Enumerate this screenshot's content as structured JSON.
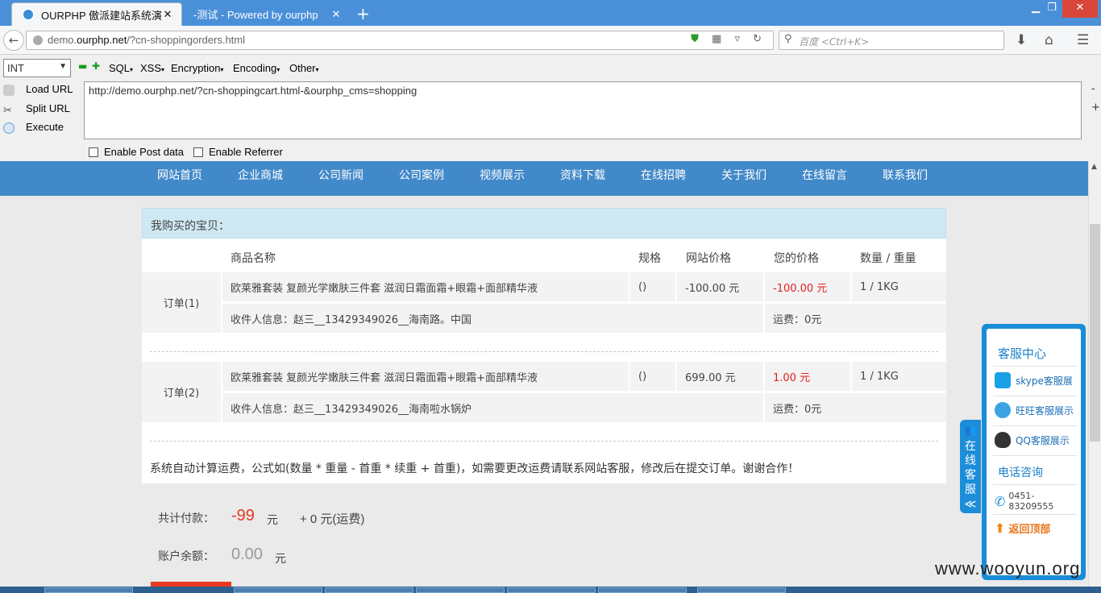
{
  "browser": {
    "tabs": [
      {
        "label": "OURPHP 傲派建站系统演..."
      },
      {
        "label": "-测试 - Powered by ourphp"
      }
    ],
    "url_prefix": "demo.",
    "url_domain": "ourphp.net",
    "url_path": "/?cn-shoppingorders.html",
    "search_placeholder": "百度 <Ctrl+K>"
  },
  "hackbar": {
    "select_value": "INT",
    "menus": [
      "SQL",
      "XSS",
      "Encryption",
      "Encoding",
      "Other"
    ],
    "actions": [
      "Load URL",
      "Split URL",
      "Execute"
    ],
    "text": "http://demo.ourphp.net/?cn-shoppingcart.html-&ourphp_cms=shopping",
    "post_label": "Enable Post data",
    "referrer_label": "Enable Referrer"
  },
  "site_nav": [
    "网站首页",
    "企业商城",
    "公司新闻",
    "公司案例",
    "视频展示",
    "资料下载",
    "在线招聘",
    "关于我们",
    "在线留言",
    "联系我们"
  ],
  "orders": {
    "heading": "我购买的宝贝：",
    "columns": [
      "商品名称",
      "规格",
      "网站价格",
      "您的价格",
      "数量 / 重量"
    ],
    "items": [
      {
        "order_label": "订单(1)",
        "product": "欧莱雅套装 复颜光学嫩肤三件套 滋润日霜面霜+眼霜+面部精华液",
        "spec": "()",
        "site_price": "-100.00 元",
        "your_price": "-100.00 元",
        "qty_weight": "1  /  1KG",
        "receiver": "收件人信息：赵三__13429349026__海南路。中国",
        "shipping": "运费：0元"
      },
      {
        "order_label": "订单(2)",
        "product": "欧莱雅套装 复颜光学嫩肤三件套 滋润日霜面霜+眼霜+面部精华液",
        "spec": "()",
        "site_price": "699.00 元",
        "your_price": "1.00 元",
        "qty_weight": "1  /  1KG",
        "receiver": "收件人信息：赵三__13429349026__海南啦水锅炉",
        "shipping": "运费：0元"
      }
    ],
    "notice": "系统自动计算运费，公式如(数量 * 重量 - 首重 * 续重 + 首重)，如需要更改运费请联系网站客服，修改后在提交订单。谢谢合作！"
  },
  "totals": {
    "total_label": "共计付款：",
    "total_value": "-99",
    "total_unit": "元",
    "shipping_extra": "+ 0  元(运费)",
    "balance_label": "账户余额：",
    "balance_value": "0.00",
    "balance_unit": "元"
  },
  "service_widget": {
    "tab_text": "在线客服",
    "tab_arrow": "≪",
    "title": "客服中心",
    "items": [
      "skype客服展",
      "旺旺客服展示",
      "QQ客服展示"
    ],
    "phone_title": "电话咨询",
    "phone": "0451-83209555",
    "back_top": "返回顶部"
  },
  "watermark": "www.wooyun.org",
  "colors": {
    "accent": "#4289c9",
    "price_red": "#e02020",
    "total_red": "#e8391f"
  }
}
